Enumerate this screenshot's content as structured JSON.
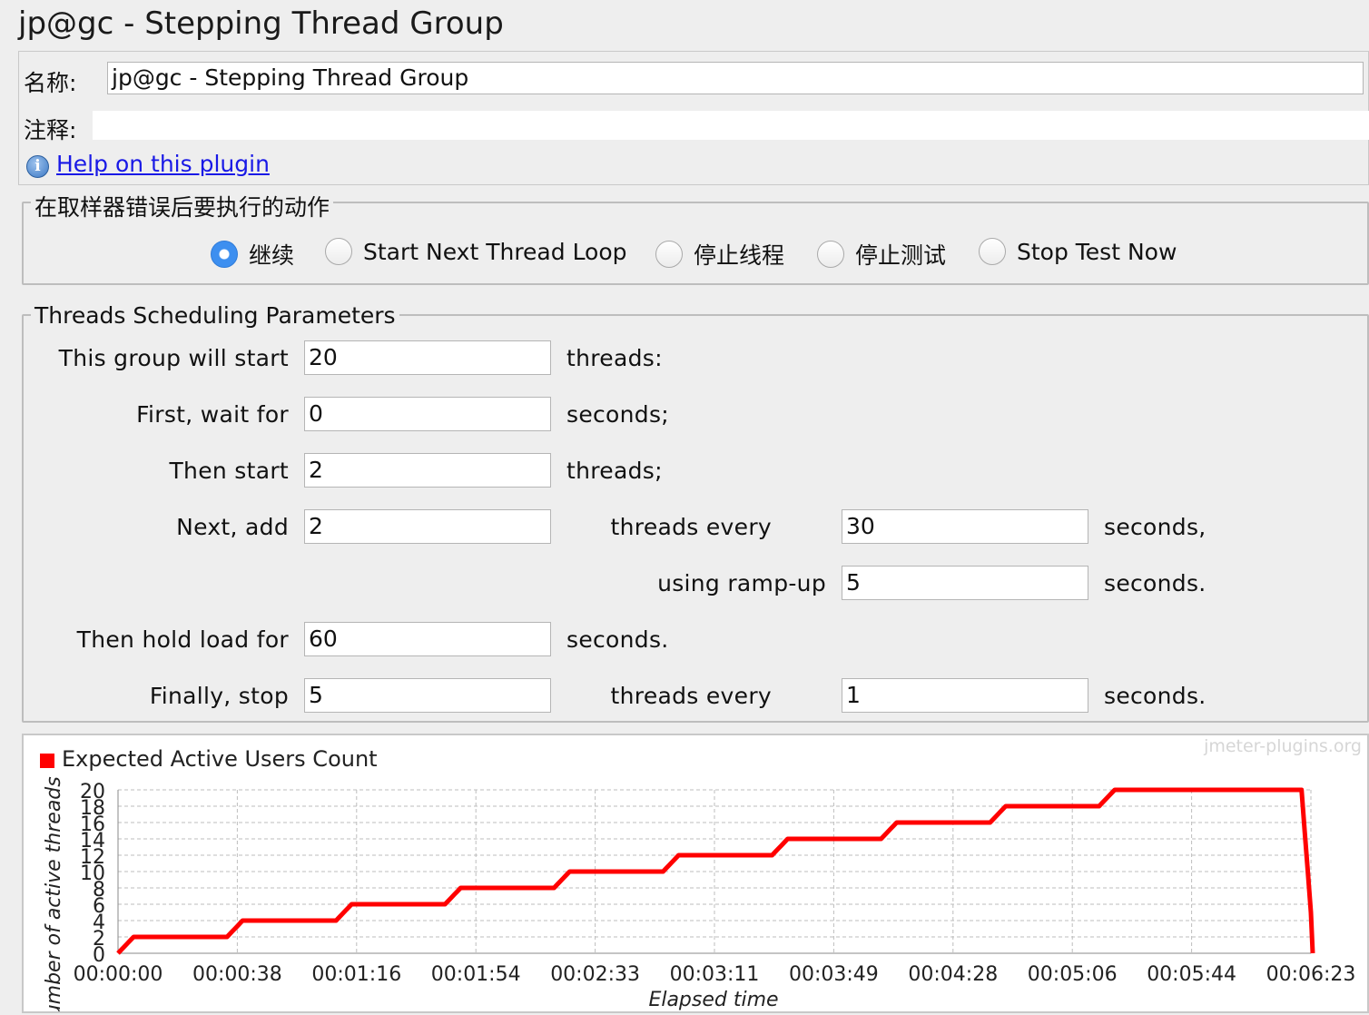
{
  "window": {
    "title": "jp@gc - Stepping Thread Group"
  },
  "name_section": {
    "name_label": "名称:",
    "name_value": "jp@gc - Stepping Thread Group",
    "comment_label": "注释:",
    "comment_value": "",
    "help_link": "Help on this plugin",
    "help_icon": "info-icon"
  },
  "error_action": {
    "title": "在取样器错误后要执行的动作",
    "options": [
      {
        "label": "继续",
        "selected": true
      },
      {
        "label": "Start Next Thread Loop",
        "selected": false
      },
      {
        "label": "停止线程",
        "selected": false
      },
      {
        "label": "停止测试",
        "selected": false
      },
      {
        "label": "Stop Test Now",
        "selected": false
      }
    ]
  },
  "scheduling": {
    "title": "Threads Scheduling Parameters",
    "start_label": "This group will start",
    "start_value": "20",
    "start_unit": "threads:",
    "wait_label": "First, wait for",
    "wait_value": "0",
    "wait_unit": "seconds;",
    "then_start_label": "Then start",
    "then_start_value": "2",
    "then_start_unit": "threads;",
    "add_label": "Next, add",
    "add_value": "2",
    "add_every_label": "threads every",
    "add_every_value": "30",
    "add_every_unit": "seconds,",
    "rampup_label": "using ramp-up",
    "rampup_value": "5",
    "rampup_unit": "seconds.",
    "hold_label": "Then hold load for",
    "hold_value": "60",
    "hold_unit": "seconds.",
    "stop_label": "Finally, stop",
    "stop_value": "5",
    "stop_every_label": "threads every",
    "stop_every_value": "1",
    "stop_every_unit": "seconds."
  },
  "chart_data": {
    "type": "line",
    "title": "",
    "watermark": "jmeter-plugins.org",
    "legend": "top-left",
    "xlabel": "Elapsed time",
    "ylabel": "Number of active threads",
    "ylim": [
      0,
      20
    ],
    "xlim_seconds": [
      0,
      383
    ],
    "grid": true,
    "y_ticks": [
      "0",
      "2",
      "4",
      "6",
      "8",
      "10",
      "12",
      "14",
      "16",
      "18",
      "20"
    ],
    "x_ticks": [
      "00:00:00",
      "00:00:38",
      "00:01:16",
      "00:01:54",
      "00:02:33",
      "00:03:11",
      "00:03:49",
      "00:04:28",
      "00:05:06",
      "00:05:44",
      "00:06:23"
    ],
    "series": [
      {
        "name": "Expected Active Users Count",
        "color": "#ff0000",
        "x": [
          0,
          1,
          2,
          3,
          4,
          5,
          35,
          36,
          37,
          38,
          39,
          40,
          70,
          71,
          72,
          73,
          74,
          75,
          105,
          106,
          107,
          108,
          109,
          110,
          140,
          141,
          142,
          143,
          144,
          145,
          175,
          176,
          177,
          178,
          179,
          180,
          210,
          211,
          212,
          213,
          214,
          215,
          245,
          246,
          247,
          248,
          249,
          250,
          280,
          281,
          282,
          283,
          284,
          285,
          315,
          316,
          317,
          318,
          319,
          320,
          380,
          381,
          382,
          383,
          384,
          385
        ],
        "y": [
          0,
          0.4,
          0.8,
          1.2,
          1.6,
          2,
          2,
          2.4,
          2.8,
          3.2,
          3.6,
          4,
          4,
          4.4,
          4.8,
          5.2,
          5.6,
          6,
          6,
          6.4,
          6.8,
          7.2,
          7.6,
          8,
          8,
          8.4,
          8.8,
          9.2,
          9.6,
          10,
          10,
          10.4,
          10.8,
          11.2,
          11.6,
          12,
          12,
          12.4,
          12.8,
          13.2,
          13.6,
          14,
          14,
          14.4,
          14.8,
          15.2,
          15.6,
          16,
          16,
          16.4,
          16.8,
          17.2,
          17.6,
          18,
          18,
          18.4,
          18.8,
          19.2,
          19.6,
          20,
          20,
          15,
          10,
          5,
          0,
          0
        ]
      }
    ]
  }
}
